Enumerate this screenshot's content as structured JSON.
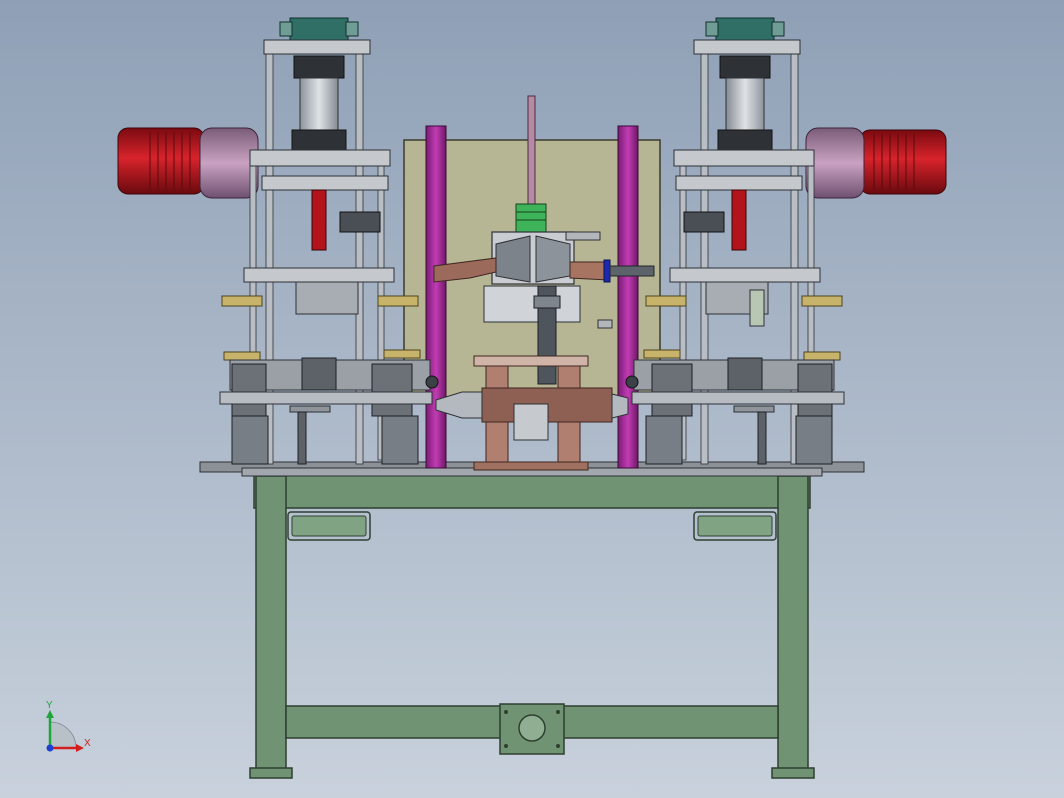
{
  "viewport": {
    "background_top": "#8fa0b6",
    "background_bottom": "#c8d1dc"
  },
  "triad": {
    "x_label": "X",
    "y_label": "Y",
    "x_color": "#d21e1e",
    "y_color": "#1fa63a",
    "z_color": "#1d3fd6"
  },
  "colors": {
    "frame": "#6f9373",
    "frame_edge": "#2f3f30",
    "motor_red": "#b4141c",
    "motor_gearbox": "#b98fb0",
    "pillar_magenta": "#a52a9b",
    "back_panel": "#b7b694",
    "cylinder_teal": "#2f6f66",
    "steel": "#b9bec5",
    "dark_steel": "#3a3f45",
    "coupling_green": "#3fb35a",
    "copper": "#9c6a5a"
  }
}
